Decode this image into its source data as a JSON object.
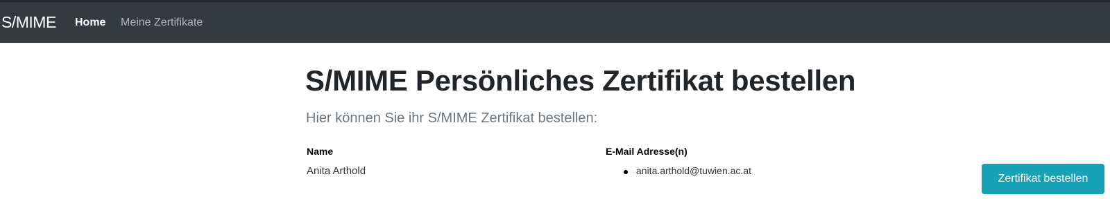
{
  "navbar": {
    "brand": "S/MIME",
    "links": [
      {
        "label": "Home",
        "active": true
      },
      {
        "label": "Meine Zertifikate",
        "active": false
      }
    ]
  },
  "main": {
    "title": "S/MIME Persönliches Zertifikat bestellen",
    "lead": "Hier können Sie ihr S/MIME Zertifikat bestellen:",
    "name_label": "Name",
    "name_value": "Anita Arthold",
    "email_label": "E-Mail Adresse(n)",
    "emails": [
      "anita.arthold@tuwien.ac.at"
    ],
    "order_button": "Zertifikat bestellen"
  },
  "colors": {
    "navbar_bg": "#343a40",
    "button_bg": "#17a2b8",
    "lead_text": "#6c757d"
  }
}
